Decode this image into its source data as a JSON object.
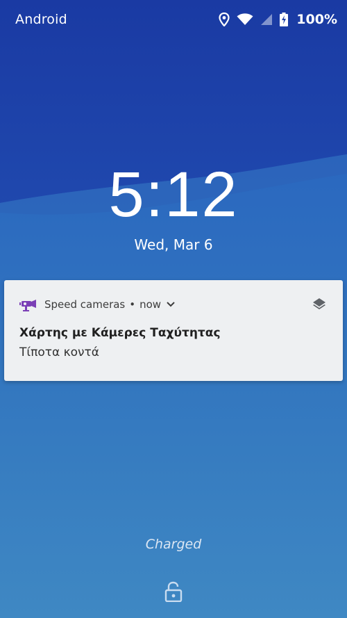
{
  "status_bar": {
    "carrier": "Android",
    "battery_percent": "100%",
    "icons": [
      "location-icon",
      "wifi-icon",
      "cell-signal-icon",
      "battery-charging-icon"
    ]
  },
  "lockscreen": {
    "time": "5:12",
    "date": "Wed, Mar 6",
    "charging_status": "Charged"
  },
  "notification": {
    "app_name": "Speed cameras",
    "separator": "•",
    "timestamp": "now",
    "title": "Χάρτης με Κάμερες Ταχύτητας",
    "text": "Τίποτα κοντά",
    "app_icon": "speed-camera-icon",
    "app_icon_color": "#7b3fb6"
  },
  "colors": {
    "wallpaper_top": "#1c3fa6",
    "wallpaper_bottom": "#3d86c4",
    "notification_bg": "#eef0f2"
  }
}
